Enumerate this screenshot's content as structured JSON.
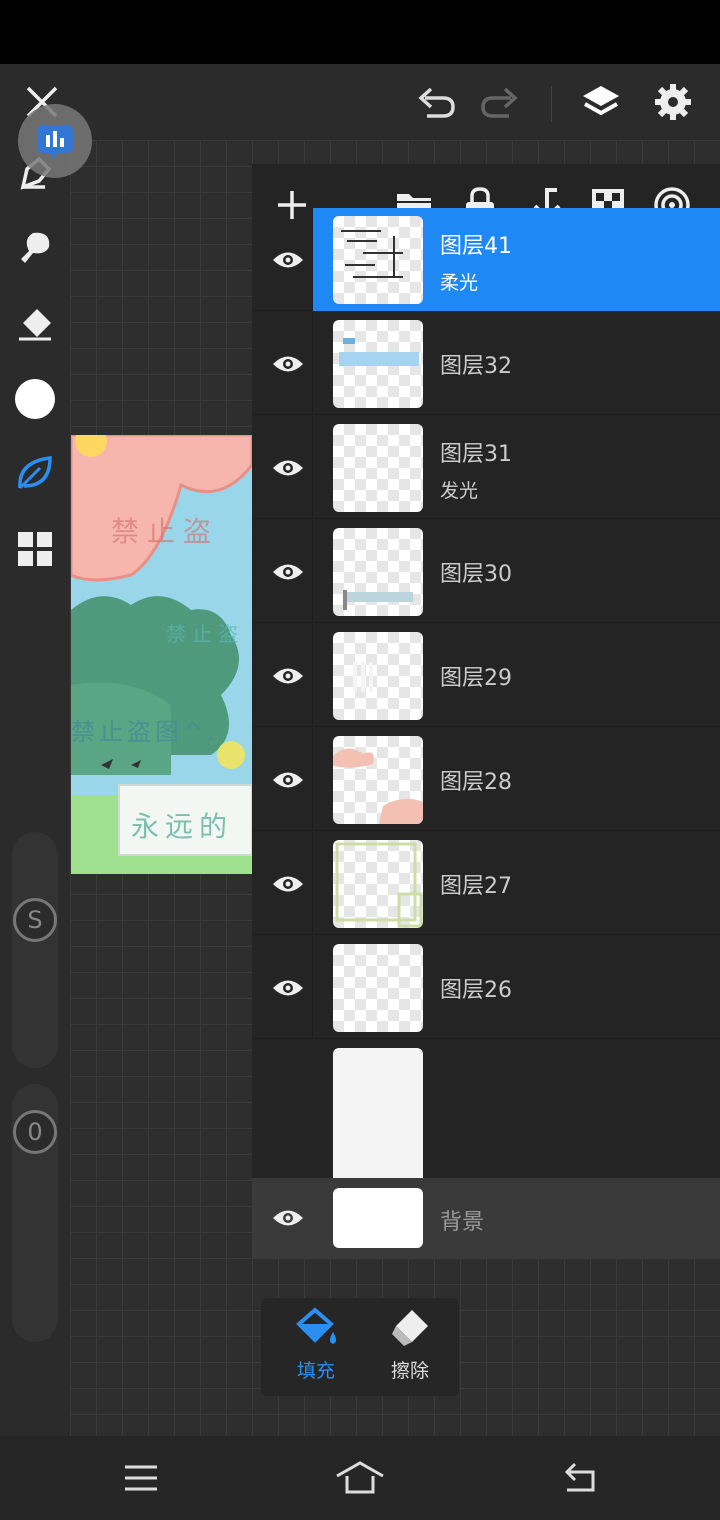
{
  "top_bar": {
    "icons": [
      "close-icon",
      "undo-icon",
      "redo-icon",
      "layers-icon",
      "settings-icon"
    ]
  },
  "left_tools": [
    "brush-icon",
    "smudge-icon",
    "eraser-icon",
    "color-swatch",
    "leaf-brush-icon",
    "grid-tool-icon"
  ],
  "sliders": {
    "size_label": "S",
    "opacity_label": "0"
  },
  "artwork": {
    "text_1": "禁止盗",
    "text_2": "禁止盗",
    "text_3": "禁止盗图^.",
    "text_4": "永远的"
  },
  "layers_toolbar": [
    "add-layer-icon",
    "folder-icon",
    "lock-icon",
    "merge-down-icon",
    "transparency-icon",
    "blend-target-icon"
  ],
  "layers": [
    {
      "name": "图层41",
      "mode": "柔光",
      "selected": true
    },
    {
      "name": "图层32",
      "mode": "",
      "selected": false
    },
    {
      "name": "图层31",
      "mode": "发光",
      "selected": false
    },
    {
      "name": "图层30",
      "mode": "",
      "selected": false
    },
    {
      "name": "图层29",
      "mode": "",
      "selected": false
    },
    {
      "name": "图层28",
      "mode": "",
      "selected": false
    },
    {
      "name": "图层27",
      "mode": "",
      "selected": false
    },
    {
      "name": "图层26",
      "mode": "",
      "selected": false
    }
  ],
  "background_layer": {
    "name": "背景"
  },
  "fill_popup": {
    "fill_label": "填充",
    "erase_label": "擦除"
  },
  "colors": {
    "accent": "#1e88f5",
    "panel": "#242424"
  },
  "nav": [
    "menu-icon",
    "home-icon",
    "back-icon"
  ]
}
